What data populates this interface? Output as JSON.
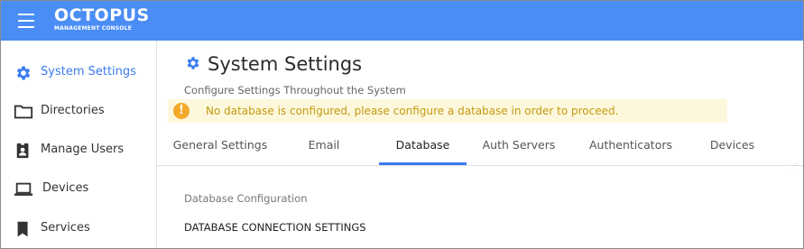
{
  "header": {
    "brand_name": "OCTOPUS",
    "brand_subtitle": "MANAGEMENT CONSOLE",
    "color": "#4a8df5"
  },
  "sidebar": {
    "items": [
      {
        "label": "System Settings",
        "icon": "gear-icon",
        "active": true
      },
      {
        "label": "Directories",
        "icon": "folder-icon",
        "active": false
      },
      {
        "label": "Manage Users",
        "icon": "user-badge-icon",
        "active": false
      },
      {
        "label": "Devices",
        "icon": "laptop-icon",
        "active": false
      },
      {
        "label": "Services",
        "icon": "bookmark-icon",
        "active": false
      }
    ]
  },
  "page": {
    "title": "System Settings",
    "subtitle": "Configure Settings Throughout the System"
  },
  "warning": {
    "text": "No database is configured, please configure a database in order to proceed.",
    "icon": "exclamation-icon"
  },
  "tabs": [
    {
      "label": "General Settings",
      "active": false
    },
    {
      "label": "Email",
      "active": false
    },
    {
      "label": "Database",
      "active": true
    },
    {
      "label": "Auth Servers",
      "active": false
    },
    {
      "label": "Authenticators",
      "active": false
    },
    {
      "label": "Devices",
      "active": false
    }
  ],
  "database": {
    "section_label": "Database Configuration",
    "connection_heading": "DATABASE CONNECTION SETTINGS"
  },
  "colors": {
    "accent": "#3a7bf0",
    "warning_bg": "#fdf8dc",
    "warning_text": "#c39a10",
    "warning_icon": "#f3a92b"
  }
}
